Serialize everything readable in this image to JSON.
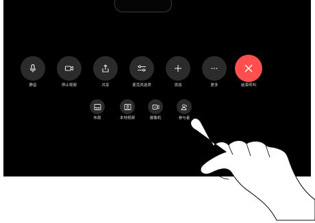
{
  "controls": {
    "row1": [
      {
        "label": "静音",
        "icon": "microphone-icon"
      },
      {
        "label": "停止视频",
        "icon": "video-camera-icon"
      },
      {
        "label": "共享",
        "icon": "share-icon"
      },
      {
        "label": "麦克风选项",
        "icon": "sliders-icon"
      },
      {
        "label": "添加",
        "icon": "plus-icon"
      },
      {
        "label": "更多",
        "icon": "more-dots-icon"
      },
      {
        "label": "结束呼叫",
        "icon": "end-call-x-icon"
      }
    ],
    "row2": [
      {
        "label": "布局",
        "icon": "layout-icon"
      },
      {
        "label": "本地视频",
        "icon": "self-view-icon"
      },
      {
        "label": "摄像机",
        "icon": "camera-control-icon"
      },
      {
        "label": "参与者",
        "icon": "participants-icon"
      }
    ]
  },
  "colors": {
    "screen": "#000000",
    "button": "#2b2b2b",
    "end_call": "#ff4f4f",
    "icon": "#e6e6e6"
  }
}
